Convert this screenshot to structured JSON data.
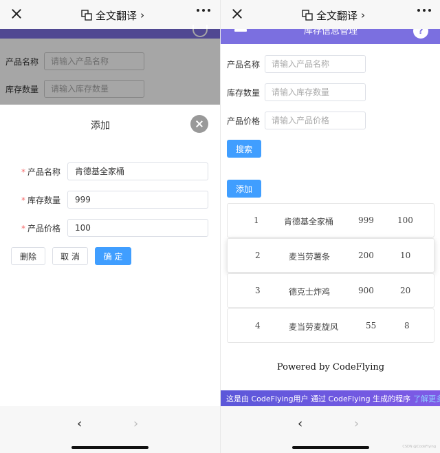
{
  "topbar": {
    "translate_label": "全文翻译",
    "chevron": "›"
  },
  "left": {
    "page_fields": [
      {
        "label": "产品名称",
        "placeholder": "请输入产品名称"
      },
      {
        "label": "库存数量",
        "placeholder": "请输入库存数量"
      }
    ],
    "dialog": {
      "title": "添加",
      "required_mark": "*",
      "fields": [
        {
          "label": "产品名称",
          "value": "肯德基全家桶"
        },
        {
          "label": "库存数量",
          "value": "999"
        },
        {
          "label": "产品价格",
          "value": "100"
        }
      ],
      "buttons": {
        "delete": "删除",
        "cancel": "取 消",
        "confirm": "确 定"
      }
    }
  },
  "right": {
    "header_title": "库存信息管理",
    "help_icon_text": "?",
    "search_fields": [
      {
        "label": "产品名称",
        "placeholder": "请输入产品名称"
      },
      {
        "label": "库存数量",
        "placeholder": "请输入库存数量"
      },
      {
        "label": "产品价格",
        "placeholder": "请输入产品价格"
      }
    ],
    "search_button": "搜索",
    "add_button": "添加",
    "items": [
      {
        "id": "1",
        "name": "肯德基全家桶",
        "qty": "999",
        "price": "100"
      },
      {
        "id": "2",
        "name": "麦当劳薯条",
        "qty": "200",
        "price": "10"
      },
      {
        "id": "3",
        "name": "德克士炸鸡",
        "qty": "900",
        "price": "20"
      },
      {
        "id": "4",
        "name": "麦当劳麦旋风",
        "qty": "55",
        "price": "8"
      }
    ],
    "powered_by": "Powered by CodeFlying",
    "banner_text": "这是由 CodeFlying用户 通过 CodeFlying 生成的程序",
    "banner_link": "了解更多"
  },
  "nav": {
    "back": "‹",
    "forward": "›"
  },
  "watermark": "CSDN @CodeFlying",
  "icons": {
    "close": "close-icon",
    "translate": "translate-icon",
    "more": "more-icon",
    "dialog_close": "close-circle-icon",
    "back": "back-arrow-icon",
    "forward": "forward-arrow-icon",
    "menu": "menu-icon",
    "help": "help-icon"
  },
  "colors": {
    "primary": "#409eff",
    "header": "#7b6fe0",
    "required": "#f56c6c"
  }
}
